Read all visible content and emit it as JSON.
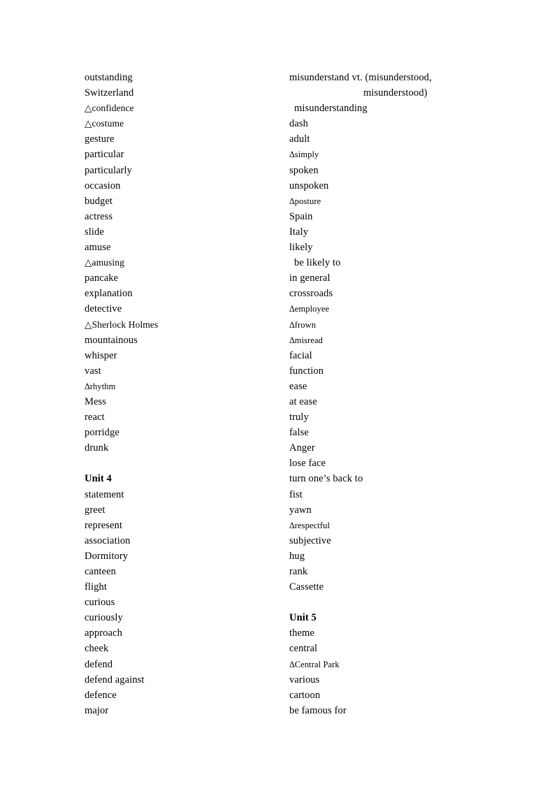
{
  "document": {
    "type": "vocabulary-word-list",
    "page_background": "#ffffff",
    "text_color": "#000000",
    "columns": [
      {
        "id": "left-column",
        "lines": [
          {
            "text": "outstanding",
            "style": "plain"
          },
          {
            "text": "Switzerland",
            "style": "plain"
          },
          {
            "text": "△confidence",
            "style": "triangle-big"
          },
          {
            "text": "△costume",
            "style": "triangle-big"
          },
          {
            "text": "gesture",
            "style": "plain"
          },
          {
            "text": "particular",
            "style": "plain"
          },
          {
            "text": "particularly",
            "style": "plain"
          },
          {
            "text": "occasion",
            "style": "plain"
          },
          {
            "text": "budget",
            "style": "plain"
          },
          {
            "text": "actress",
            "style": "plain"
          },
          {
            "text": "slide",
            "style": "plain"
          },
          {
            "text": "amuse",
            "style": "plain"
          },
          {
            "text": "△amusing",
            "style": "triangle-big"
          },
          {
            "text": "pancake",
            "style": "plain"
          },
          {
            "text": "explanation",
            "style": "plain"
          },
          {
            "text": "detective",
            "style": "plain"
          },
          {
            "text": "△Sherlock Holmes",
            "style": "triangle-big"
          },
          {
            "text": "mountainous",
            "style": "plain"
          },
          {
            "text": "whisper",
            "style": "plain"
          },
          {
            "text": "vast",
            "style": "plain"
          },
          {
            "text": "∆rhythm",
            "style": "triangle-small"
          },
          {
            "text": "Mess",
            "style": "plain"
          },
          {
            "text": "react",
            "style": "plain"
          },
          {
            "text": "porridge",
            "style": "plain"
          },
          {
            "text": "drunk",
            "style": "plain"
          },
          {
            "text": "",
            "style": "blank"
          },
          {
            "text": "Unit 4",
            "style": "unit-heading"
          },
          {
            "text": "statement",
            "style": "plain"
          },
          {
            "text": "greet",
            "style": "plain"
          },
          {
            "text": "represent",
            "style": "plain"
          },
          {
            "text": "association",
            "style": "plain"
          },
          {
            "text": "Dormitory",
            "style": "plain"
          },
          {
            "text": "canteen",
            "style": "plain"
          },
          {
            "text": "flight",
            "style": "plain"
          },
          {
            "text": "curious",
            "style": "plain"
          },
          {
            "text": "curiously",
            "style": "plain"
          },
          {
            "text": "approach",
            "style": "plain"
          },
          {
            "text": "cheek",
            "style": "plain"
          },
          {
            "text": "defend",
            "style": "plain"
          },
          {
            "text": "defend against",
            "style": "plain"
          },
          {
            "text": "defence",
            "style": "plain"
          },
          {
            "text": "major",
            "style": "plain"
          }
        ]
      },
      {
        "id": "right-column",
        "lines": [
          {
            "text": "misunderstand vt. (misunderstood,",
            "style": "plain"
          },
          {
            "text": "misunderstood)",
            "style": "continuation"
          },
          {
            "text": "misunderstanding",
            "style": "indented"
          },
          {
            "text": "dash",
            "style": "plain"
          },
          {
            "text": "adult",
            "style": "plain"
          },
          {
            "text": "∆simply",
            "style": "triangle-small"
          },
          {
            "text": "spoken",
            "style": "plain"
          },
          {
            "text": "unspoken",
            "style": "plain"
          },
          {
            "text": "∆posture",
            "style": "triangle-small"
          },
          {
            "text": "Spain",
            "style": "plain"
          },
          {
            "text": "Italy",
            "style": "plain"
          },
          {
            "text": "likely",
            "style": "plain"
          },
          {
            "text": "be likely to",
            "style": "indented"
          },
          {
            "text": "in general",
            "style": "plain"
          },
          {
            "text": "crossroads",
            "style": "plain"
          },
          {
            "text": "∆employee",
            "style": "triangle-small"
          },
          {
            "text": "∆frown",
            "style": "triangle-small"
          },
          {
            "text": "∆misread",
            "style": "triangle-small"
          },
          {
            "text": "facial",
            "style": "plain"
          },
          {
            "text": "function",
            "style": "plain"
          },
          {
            "text": "ease",
            "style": "plain"
          },
          {
            "text": "at ease",
            "style": "plain"
          },
          {
            "text": "truly",
            "style": "plain"
          },
          {
            "text": "false",
            "style": "plain"
          },
          {
            "text": "Anger",
            "style": "plain"
          },
          {
            "text": "lose face",
            "style": "plain"
          },
          {
            "text": "turn one’s back to",
            "style": "plain"
          },
          {
            "text": "fist",
            "style": "plain"
          },
          {
            "text": "yawn",
            "style": "plain"
          },
          {
            "text": "∆respectful",
            "style": "triangle-small"
          },
          {
            "text": "subjective",
            "style": "plain"
          },
          {
            "text": "hug",
            "style": "plain"
          },
          {
            "text": "rank",
            "style": "plain"
          },
          {
            "text": "Cassette",
            "style": "plain"
          },
          {
            "text": "",
            "style": "blank"
          },
          {
            "text": "Unit 5",
            "style": "unit-heading"
          },
          {
            "text": "theme",
            "style": "plain"
          },
          {
            "text": "central",
            "style": "plain"
          },
          {
            "text": "∆Central Park",
            "style": "triangle-small"
          },
          {
            "text": "various",
            "style": "plain"
          },
          {
            "text": "cartoon",
            "style": "plain"
          },
          {
            "text": "be famous for",
            "style": "plain"
          }
        ]
      }
    ]
  }
}
